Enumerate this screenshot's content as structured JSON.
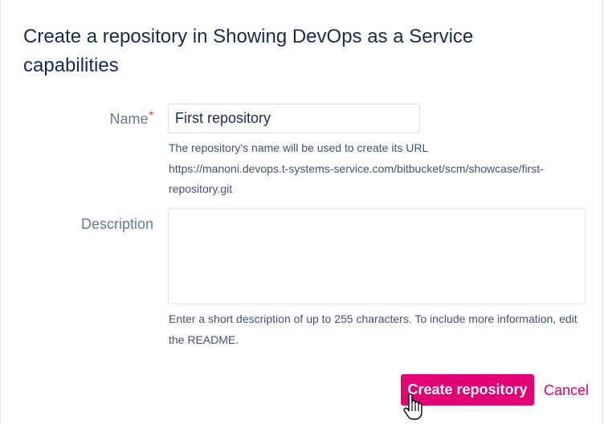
{
  "dialog": {
    "title": "Create a repository in Showing DevOps as a Service capabilities"
  },
  "form": {
    "name": {
      "label": "Name",
      "required_marker": "*",
      "value": "First repository",
      "help_line1": "The repository's name will be used to create its URL",
      "help_line2": "https://manoni.devops.t-systems-service.com/bitbucket/scm/showcase/first-repository.git"
    },
    "description": {
      "label": "Description",
      "value": "",
      "help": "Enter a short description of up to 255 characters. To include more information, edit the README."
    }
  },
  "actions": {
    "create_label": "Create repository",
    "cancel_label": "Cancel"
  },
  "colors": {
    "accent": "#e20074",
    "title": "#172b4d",
    "label": "#6b778c",
    "required": "#de350b"
  },
  "icons": {
    "cursor": "hand-pointer-icon"
  }
}
